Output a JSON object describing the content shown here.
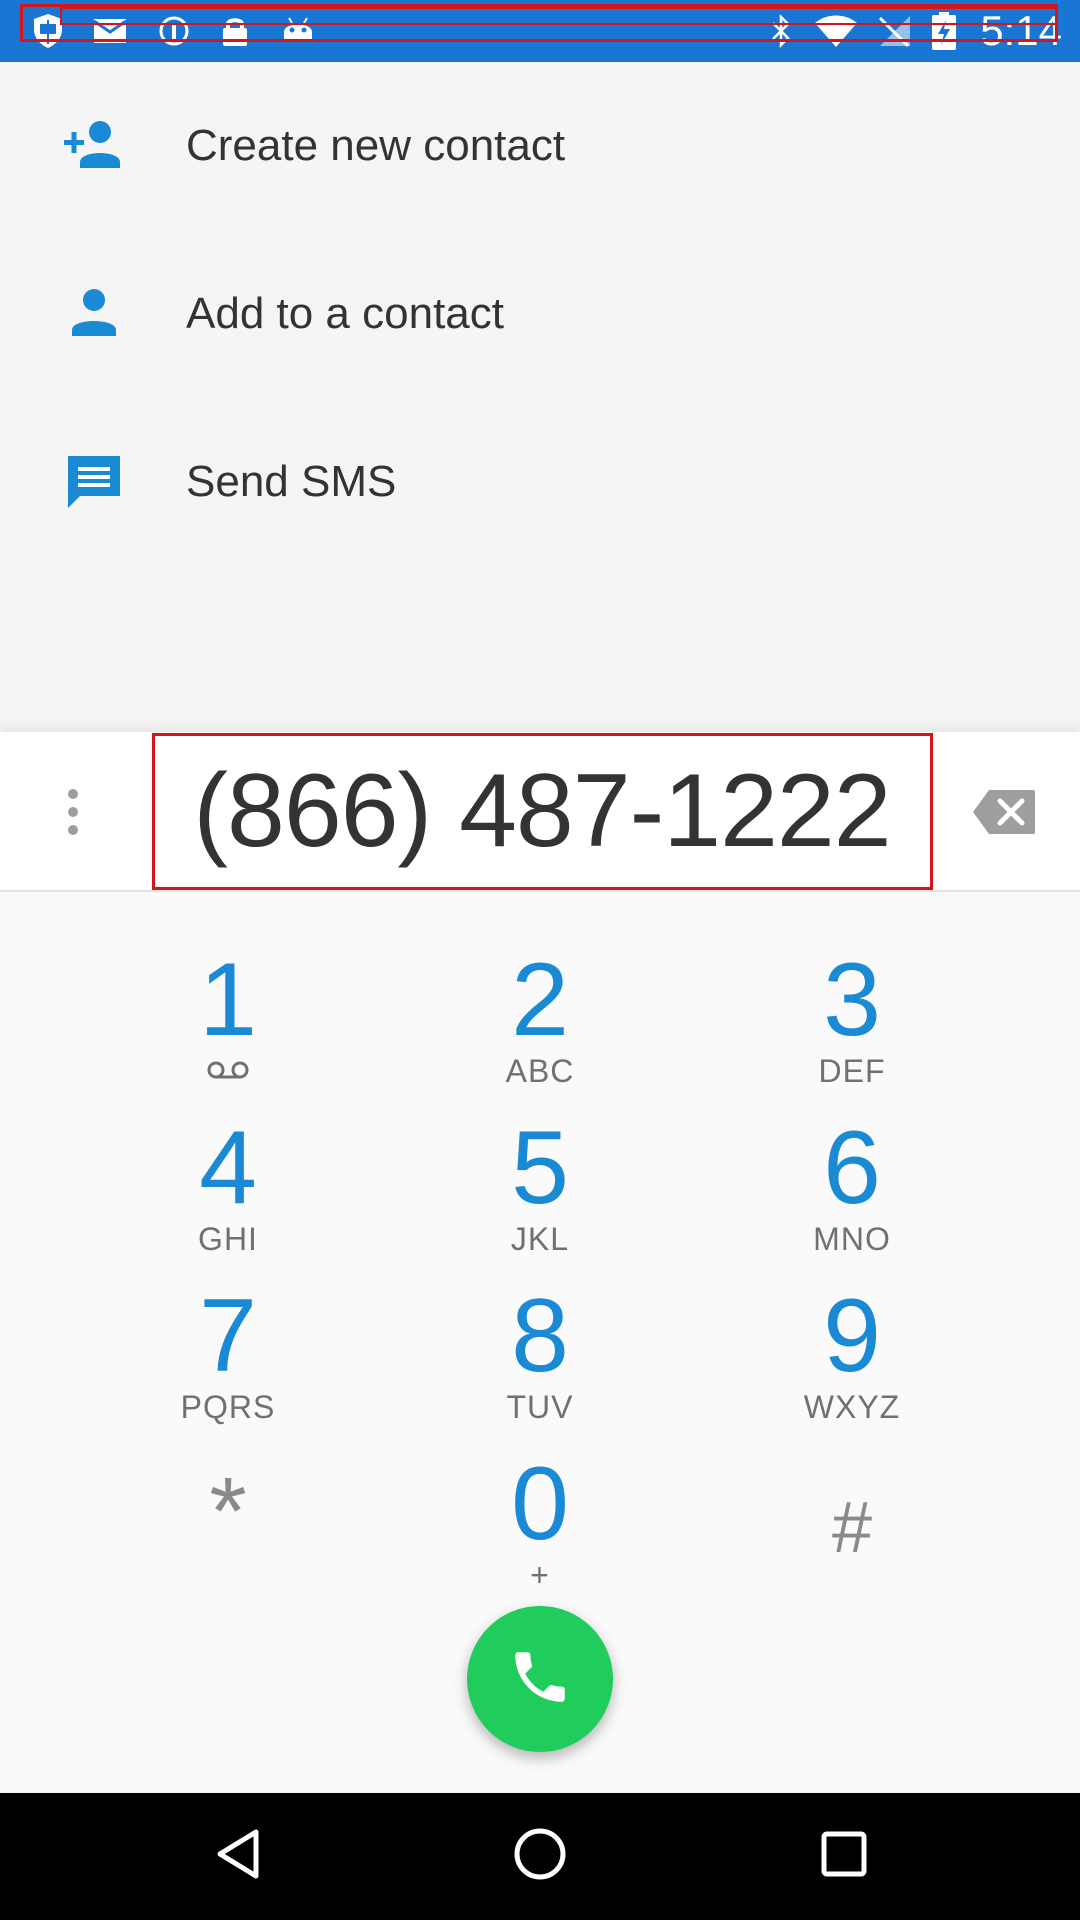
{
  "status_bar": {
    "time": "5:14",
    "background": "#1976d2",
    "left_icons": [
      "shield-icon",
      "email-icon",
      "sync-icon",
      "lock-icon",
      "android-icon"
    ],
    "right_icons": [
      "bluetooth-icon",
      "wifi-icon",
      "no-signal-icon",
      "battery-charging-icon"
    ]
  },
  "actions": [
    {
      "label": "Create new contact",
      "icon": "add-person-icon"
    },
    {
      "label": "Add to a contact",
      "icon": "person-icon"
    },
    {
      "label": "Send SMS",
      "icon": "message-icon"
    }
  ],
  "dialer": {
    "number": "(866) 487-1222",
    "accent": "#1a8ad4",
    "call_color": "#1fcc5c",
    "keys": [
      {
        "digit": "1",
        "letters": ""
      },
      {
        "digit": "2",
        "letters": "ABC"
      },
      {
        "digit": "3",
        "letters": "DEF"
      },
      {
        "digit": "4",
        "letters": "GHI"
      },
      {
        "digit": "5",
        "letters": "JKL"
      },
      {
        "digit": "6",
        "letters": "MNO"
      },
      {
        "digit": "7",
        "letters": "PQRS"
      },
      {
        "digit": "8",
        "letters": "TUV"
      },
      {
        "digit": "9",
        "letters": "WXYZ"
      },
      {
        "digit": "*",
        "letters": ""
      },
      {
        "digit": "0",
        "letters": "+"
      },
      {
        "digit": "#",
        "letters": ""
      }
    ]
  },
  "nav_bar": {
    "buttons": [
      "back-icon",
      "home-icon",
      "recents-icon"
    ]
  }
}
